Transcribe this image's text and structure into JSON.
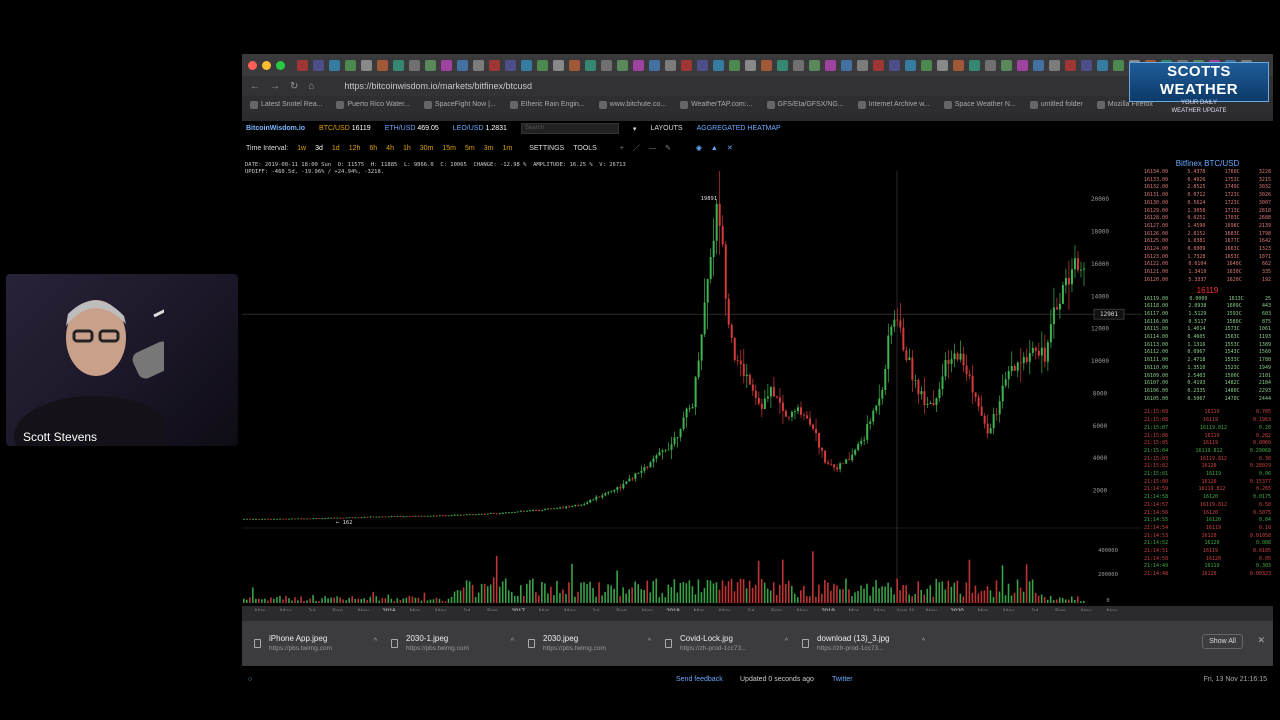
{
  "webcam": {
    "name": "Scott Stevens"
  },
  "browser": {
    "url": "https://bitcoinwisdom.io/markets/bitfinex/btcusd",
    "bookmarks": [
      "Latest Snotel Rea...",
      "Puerto Rico Water...",
      "SpaceFight Now |...",
      "Etheric Rain Engin...",
      "www.bitchute.co...",
      "WeatherTAP.com:...",
      "GFS/Eta/GFSX/NG...",
      "Internet Archive w...",
      "Space Weather N...",
      "untitled folder",
      "Mozilla Firefox"
    ]
  },
  "overlay_logo": {
    "title": "SCOTTS WEATHER",
    "line1": "YOUR DAILY",
    "line2": "WEATHER UPDATE"
  },
  "site": {
    "logo": "BitcoinWisdom.io",
    "pairs": [
      {
        "name": "BTC/USD",
        "price": "16119"
      },
      {
        "name": "ETH/USD",
        "price": "469.05"
      },
      {
        "name": "LEO/USD",
        "price": "1.2831"
      }
    ],
    "search_placeholder": "Search",
    "layouts": "LAYOUTS",
    "aggregated": "AGGREGATED HEATMAP",
    "time_interval_label": "Time Interval:",
    "intervals": [
      "1w",
      "3d",
      "1d",
      "12h",
      "6h",
      "4h",
      "1h",
      "30m",
      "15m",
      "5m",
      "3m",
      "1m"
    ],
    "settings": "SETTINGS",
    "tools": "TOOLS",
    "info_line1": "DATE: 2019-08-11 18:00 Sun  O: 11575  H: 11885  L: 9866.0  C: 10065  CHANGE: -12.98 %  AMPLITUDE: 16.25 %  V: 26713",
    "info_line2": "UPDIFF: -460.5d, -19.96% / +24.94%, -3218."
  },
  "chart_data": {
    "type": "candlestick",
    "y_ticks": [
      "20000",
      "18000",
      "16000",
      "14000",
      "12000",
      "10000",
      "8000",
      "6000",
      "4000",
      "2000"
    ],
    "x_ticks": [
      "Mar",
      "May",
      "Jul",
      "Sep",
      "Nov",
      "2016",
      "Mar",
      "May",
      "Jul",
      "Sep",
      "2017",
      "Mar",
      "May",
      "Jul",
      "Sep",
      "Nov",
      "2018",
      "Mar",
      "May",
      "Jul",
      "Sep",
      "Nov",
      "2019",
      "Mar",
      "May",
      "Aug 11",
      "Nov",
      "2020",
      "Mar",
      "May",
      "Jul",
      "Sep",
      "Nov",
      "Nov"
    ],
    "volume_ticks": [
      "400000",
      "200000",
      "0"
    ],
    "annotations": {
      "peak": "19891",
      "low": "162",
      "crosshair_price": "12901"
    },
    "price_series": [
      [
        0.0,
        250
      ],
      [
        0.05,
        260
      ],
      [
        0.1,
        300
      ],
      [
        0.15,
        380
      ],
      [
        0.2,
        420
      ],
      [
        0.25,
        480
      ],
      [
        0.3,
        600
      ],
      [
        0.35,
        800
      ],
      [
        0.4,
        1100
      ],
      [
        0.45,
        2300
      ],
      [
        0.48,
        3500
      ],
      [
        0.51,
        5000
      ],
      [
        0.535,
        7500
      ],
      [
        0.545,
        12000
      ],
      [
        0.555,
        16500
      ],
      [
        0.565,
        19891
      ],
      [
        0.575,
        13500
      ],
      [
        0.585,
        10000
      ],
      [
        0.6,
        9000
      ],
      [
        0.615,
        7200
      ],
      [
        0.63,
        8200
      ],
      [
        0.645,
        6500
      ],
      [
        0.66,
        7000
      ],
      [
        0.675,
        6300
      ],
      [
        0.69,
        4000
      ],
      [
        0.705,
        3400
      ],
      [
        0.72,
        3900
      ],
      [
        0.74,
        5500
      ],
      [
        0.76,
        8500
      ],
      [
        0.77,
        12000
      ],
      [
        0.775,
        13000
      ],
      [
        0.79,
        10000
      ],
      [
        0.805,
        8000
      ],
      [
        0.82,
        7300
      ],
      [
        0.835,
        9500
      ],
      [
        0.85,
        10500
      ],
      [
        0.865,
        8800
      ],
      [
        0.875,
        7000
      ],
      [
        0.885,
        5500
      ],
      [
        0.895,
        6800
      ],
      [
        0.91,
        9200
      ],
      [
        0.925,
        9700
      ],
      [
        0.94,
        11000
      ],
      [
        0.955,
        10500
      ],
      [
        0.965,
        13000
      ],
      [
        0.975,
        14500
      ],
      [
        0.985,
        15800
      ],
      [
        0.995,
        16119
      ]
    ]
  },
  "orderbook": {
    "title": "Bitfinex BTC/USD",
    "asks": [
      [
        "16134.00",
        "5.4378",
        "1760C",
        "3228"
      ],
      [
        "16133.00",
        "0.4926",
        "1753C",
        "3215"
      ],
      [
        "16132.00",
        "2.8525",
        "1749C",
        "3032"
      ],
      [
        "16131.00",
        "0.0712",
        "1723C",
        "3026"
      ],
      [
        "16130.00",
        "0.5624",
        "1723C",
        "3007"
      ],
      [
        "16129.00",
        "1.3058",
        "1713C",
        "2818"
      ],
      [
        "16128.00",
        "0.0251",
        "1703C",
        "2688"
      ],
      [
        "16127.00",
        "1.4590",
        "1698C",
        "2139"
      ],
      [
        "16126.00",
        "2.8152",
        "1683C",
        "1798"
      ],
      [
        "16125.00",
        "1.0381",
        "1677C",
        "1642"
      ],
      [
        "16124.00",
        "0.0009",
        "1663C",
        "1323"
      ],
      [
        "16123.00",
        "1.7328",
        "1653C",
        "1071"
      ],
      [
        "16122.00",
        "0.0104",
        "1640C",
        "662"
      ],
      [
        "16121.00",
        "1.3419",
        "1630C",
        "335"
      ],
      [
        "16120.00",
        "5.3337",
        "1620C",
        "192"
      ]
    ],
    "mid": "16119",
    "bids": [
      [
        "16119.00",
        "0.0000",
        "1613C",
        "25"
      ],
      [
        "16118.00",
        "2.0938",
        "1609C",
        "443"
      ],
      [
        "16117.00",
        "1.5129",
        "1593C",
        "603"
      ],
      [
        "16116.00",
        "0.5117",
        "1580C",
        "875"
      ],
      [
        "16115.00",
        "1.4014",
        "1573C",
        "1061"
      ],
      [
        "16114.00",
        "0.4605",
        "1563C",
        "1193"
      ],
      [
        "16113.00",
        "1.1316",
        "1553C",
        "1389"
      ],
      [
        "16112.00",
        "0.0967",
        "1543C",
        "1560"
      ],
      [
        "16111.00",
        "2.4718",
        "1533C",
        "1780"
      ],
      [
        "16110.00",
        "1.3510",
        "1523C",
        "1949"
      ],
      [
        "16109.00",
        "2.5403",
        "1500C",
        "2101"
      ],
      [
        "16107.00",
        "0.4193",
        "1482C",
        "2184"
      ],
      [
        "16106.00",
        "0.2335",
        "1480C",
        "2293"
      ],
      [
        "16105.00",
        "0.5067",
        "1470C",
        "2444"
      ]
    ],
    "trades": [
      [
        "21:15:09",
        "16119",
        "0.705"
      ],
      [
        "21:15:08",
        "16119",
        "0.1963"
      ],
      [
        "21:15:07",
        "16119.812",
        "0.20"
      ],
      [
        "21:15:06",
        "16119",
        "0.282"
      ],
      [
        "21:15:05",
        "16119",
        "0.0060"
      ],
      [
        "21:15:04",
        "16119.812",
        "0.29068"
      ],
      [
        "21:15:03",
        "16119.812",
        "0.30"
      ],
      [
        "21:15:02",
        "16120",
        "0.28029"
      ],
      [
        "21:15:01",
        "16119",
        "0.06"
      ],
      [
        "21:15:00",
        "16120",
        "0.15377"
      ],
      [
        "21:14:59",
        "16119.812",
        "0.265"
      ],
      [
        "21:14:58",
        "16120",
        "0.0175"
      ],
      [
        "21:14:57",
        "16119.812",
        "0.50"
      ],
      [
        "21:14:56",
        "16120",
        "0.5075"
      ],
      [
        "21:14:55",
        "16120",
        "0.04"
      ],
      [
        "21:14:54",
        "16119",
        "0.10"
      ],
      [
        "21:14:53",
        "16120",
        "0.01058"
      ],
      [
        "21:14:52",
        "16120",
        "0.088"
      ],
      [
        "21:14:51",
        "16119",
        "0.0105"
      ],
      [
        "21:14:50",
        "16120",
        "0.05"
      ],
      [
        "21:14:49",
        "16119",
        "0.303"
      ],
      [
        "21:14:48",
        "16120",
        "0.00323"
      ]
    ]
  },
  "status": {
    "feedback": "Send feedback",
    "updated": "Updated 0 seconds ago",
    "twitter": "Twitter",
    "time": "Fri, 13 Nov 21:16:15"
  },
  "downloads": {
    "items": [
      {
        "name": "iPhone App.jpeg",
        "source": "https://pbs.twimg.com"
      },
      {
        "name": "2030-1.jpeg",
        "source": "https://pbs.twimg.com"
      },
      {
        "name": "2030.jpeg",
        "source": "https://pbs.twimg.com"
      },
      {
        "name": "Covid-Lock.jpg",
        "source": "https://zh-prod-1cc73..."
      },
      {
        "name": "download (13)_3.jpg",
        "source": "https://zh-prod-1cc73..."
      }
    ],
    "show_all": "Show All"
  },
  "colors": {
    "accent": "#6aa8ff",
    "up": "#3fb34f",
    "down": "#d43a3a",
    "pair": "#e0a000"
  }
}
